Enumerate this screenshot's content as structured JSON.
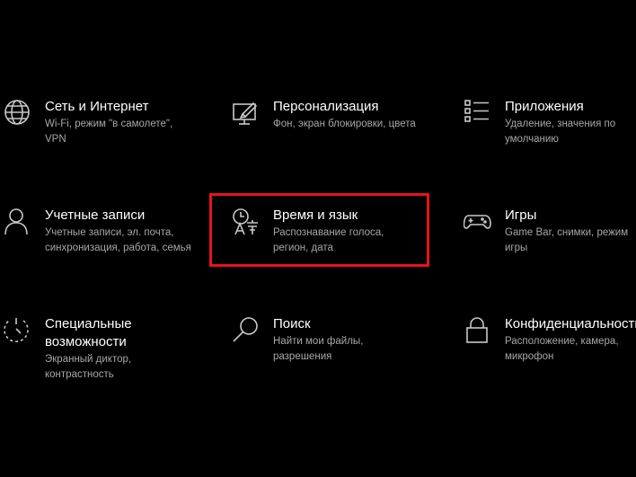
{
  "colors": {
    "background": "#000000",
    "title_text": "#ffffff",
    "description_text": "#a6a6a6",
    "icon_stroke": "#c8c8c8",
    "highlight_border": "#e8121c"
  },
  "tiles": [
    {
      "icon": "globe-icon",
      "title": "Сеть и Интернет",
      "description": "Wi-Fi, режим \"в самолете\", VPN"
    },
    {
      "icon": "personalization-icon",
      "title": "Персонализация",
      "description": "Фон, экран блокировки, цвета"
    },
    {
      "icon": "apps-list-icon",
      "title": "Приложения",
      "description": "Удаление, значения по умолчанию"
    },
    {
      "icon": "person-icon",
      "title": "Учетные записи",
      "description": "Учетные записи, эл. почта, синхронизация, работа, семья"
    },
    {
      "icon": "time-language-icon",
      "title": "Время и язык",
      "description": "Распознавание голоса, регион, дата"
    },
    {
      "icon": "gamepad-icon",
      "title": "Игры",
      "description": "Game Bar, снимки, режим игры"
    },
    {
      "icon": "ease-of-access-icon",
      "title": "Специальные возможности",
      "description": "Экранный диктор, контрастность"
    },
    {
      "icon": "search-icon",
      "title": "Поиск",
      "description": "Найти мои файлы, разрешения"
    },
    {
      "icon": "lock-icon",
      "title": "Конфиденциальность",
      "description": "Расположение, камера, микрофон"
    }
  ]
}
